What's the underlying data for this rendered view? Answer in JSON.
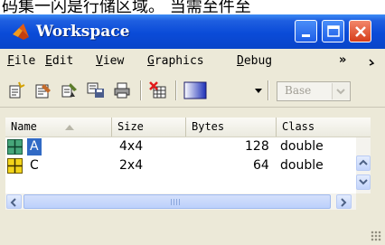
{
  "background_text": "码集一闪是行储区域。 当需至件至",
  "window": {
    "title": "Workspace",
    "controls": {
      "minimize": "minimize",
      "maximize": "maximize",
      "close": "close"
    }
  },
  "menu": {
    "items": [
      "File",
      "Edit",
      "View",
      "Graphics",
      "Debug"
    ],
    "overflow": "»"
  },
  "toolbar": {
    "icons": [
      "new-variable-icon",
      "open-variable-icon",
      "import-data-icon",
      "save-icon",
      "print-icon",
      "delete-icon",
      "plot-select-icon"
    ],
    "base_select": {
      "value": "Base",
      "enabled": false
    }
  },
  "table": {
    "columns": [
      "Name",
      "Size",
      "Bytes",
      "Class"
    ],
    "sort_column": "Name",
    "rows": [
      {
        "name": "A",
        "size": "4x4",
        "bytes": "128",
        "class": "double",
        "selected": true
      },
      {
        "name": "C",
        "size": "2x4",
        "bytes": "64",
        "class": "double",
        "selected": false
      }
    ]
  },
  "colors": {
    "titlebar": "#0a4bd8",
    "selection": "#316ac5",
    "close_button": "#d63d1a",
    "window_face": "#ece9d8"
  }
}
